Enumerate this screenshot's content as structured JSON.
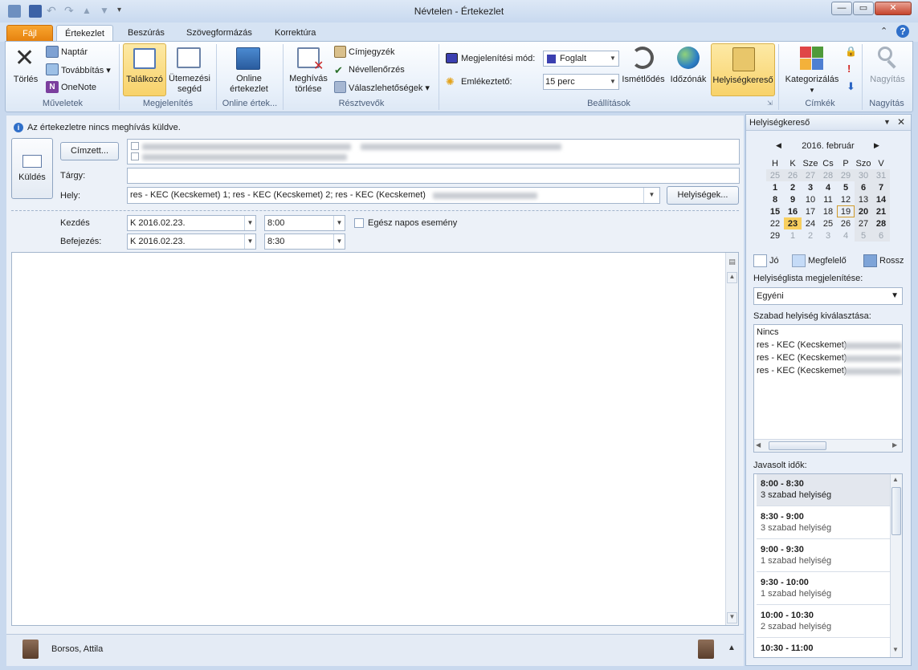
{
  "window": {
    "title": "Névtelen  -  Értekezlet",
    "buttons": {
      "minimize": "—",
      "restore": "▭",
      "close": "✕"
    }
  },
  "tabs": [
    "Fájl",
    "Értekezlet",
    "Beszúrás",
    "Szövegformázás",
    "Korrektúra"
  ],
  "ribbon": {
    "groups": {
      "actions": "Műveletek",
      "show": "Megjelenítés",
      "online": "Online értek...",
      "attendees": "Résztvevők",
      "options": "Beállítások",
      "tags": "Címkék",
      "zoom": "Nagyítás"
    },
    "delete": "Törlés",
    "calendar": "Naptár",
    "forward": "Továbbítás",
    "onenote": "OneNote",
    "meeting": "Találkozó",
    "scheduling": [
      "Ütemezési",
      "segéd"
    ],
    "online_meeting": [
      "Online",
      "értekezlet"
    ],
    "cancel_invitation": [
      "Meghívás",
      "törlése"
    ],
    "address_book": "Címjegyzék",
    "check_names": "Névellenőrzés",
    "response_options": "Válaszlehetőségek",
    "show_as_label": "Megjelenítési mód:",
    "show_as_value": "Foglalt",
    "reminder_label": "Emlékeztető:",
    "reminder_value": "15 perc",
    "recurrence": "Ismétlődés",
    "time_zones": "Időzónák",
    "room_finder": "Helyiségkereső",
    "categorize": "Kategorizálás",
    "zoom": "Nagyítás"
  },
  "form": {
    "info": "Az értekezletre nincs meghívás küldve.",
    "send": "Küldés",
    "to_button": "Címzett...",
    "subject_label": "Tárgy:",
    "subject_value": "",
    "location_label": "Hely:",
    "location_value": "res - KEC (Kecskemet)                                      1; res - KEC (Kecskemet)                                      2; res - KEC (Kecskemet)",
    "rooms_button": "Helyiségek...",
    "start_label": "Kezdés",
    "start_date": "K 2016.02.23.",
    "start_time": "8:00",
    "allday": "Egész napos esemény",
    "end_label": "Befejezés:",
    "end_date": "K 2016.02.23.",
    "end_time": "8:30",
    "attendee": "Borsos, Attila"
  },
  "pane": {
    "title": "Helyiségkereső",
    "month": "2016. február",
    "weekdays": [
      "H",
      "K",
      "Sze",
      "Cs",
      "P",
      "Szo",
      "V"
    ],
    "weeks": [
      [
        "25",
        "26",
        "27",
        "28",
        "29",
        "30",
        "31"
      ],
      [
        "1",
        "2",
        "3",
        "4",
        "5",
        "6",
        "7"
      ],
      [
        "8",
        "9",
        "10",
        "11",
        "12",
        "13",
        "14"
      ],
      [
        "15",
        "16",
        "17",
        "18",
        "19",
        "20",
        "21"
      ],
      [
        "22",
        "23",
        "24",
        "25",
        "26",
        "27",
        "28"
      ],
      [
        "29",
        "1",
        "2",
        "3",
        "4",
        "5",
        "6"
      ]
    ],
    "legend": {
      "good": "Jó",
      "fair": "Megfelelő",
      "poor": "Rossz"
    },
    "list_label": "Helyiséglista megjelenítése:",
    "list_value": "Egyéni",
    "free_label": "Szabad helyiség kiválasztása:",
    "rooms": [
      "Nincs",
      "res - KEC (Kecskemet)",
      "res - KEC (Kecskemet)",
      "res - KEC (Kecskemet)"
    ],
    "suggested_label": "Javasolt idők:",
    "suggestions": [
      {
        "time": "8:00 - 8:30",
        "rooms": "3 szabad helyiség"
      },
      {
        "time": "8:30 - 9:00",
        "rooms": "3 szabad helyiség"
      },
      {
        "time": "9:00 - 9:30",
        "rooms": "1 szabad helyiség"
      },
      {
        "time": "9:30 - 10:00",
        "rooms": "1 szabad helyiség"
      },
      {
        "time": "10:00 - 10:30",
        "rooms": "2 szabad helyiség"
      },
      {
        "time": "10:30 - 11:00",
        "rooms": ""
      }
    ]
  }
}
